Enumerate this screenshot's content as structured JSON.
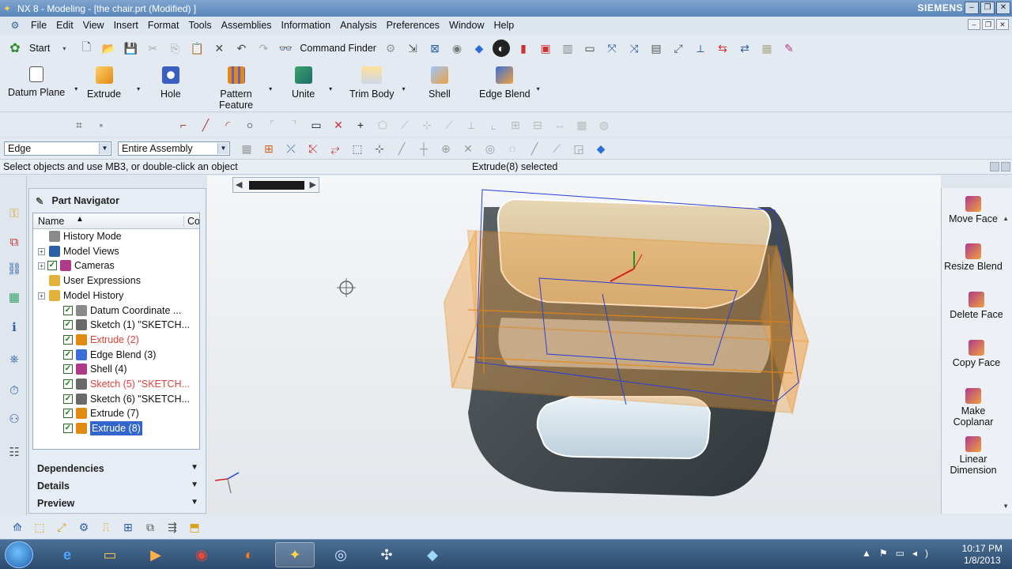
{
  "window": {
    "title": "NX 8 - Modeling - [the chair.prt (Modified) ]",
    "brand": "SIEMENS"
  },
  "menu": [
    "File",
    "Edit",
    "View",
    "Insert",
    "Format",
    "Tools",
    "Assemblies",
    "Information",
    "Analysis",
    "Preferences",
    "Window",
    "Help"
  ],
  "toolbar": {
    "start_label": "Start",
    "command_finder_label": "Command Finder"
  },
  "ribbon": [
    {
      "label": "Datum Plane",
      "icon": "datum-plane-icon"
    },
    {
      "label": "Extrude",
      "icon": "extrude-icon"
    },
    {
      "label": "Hole",
      "icon": "hole-icon"
    },
    {
      "label": "Pattern\nFeature",
      "icon": "pattern-feature-icon"
    },
    {
      "label": "Unite",
      "icon": "unite-icon"
    },
    {
      "label": "Trim Body",
      "icon": "trim-body-icon"
    },
    {
      "label": "Shell",
      "icon": "shell-icon"
    },
    {
      "label": "Edge Blend",
      "icon": "edge-blend-icon"
    }
  ],
  "selection": {
    "filter": "Edge",
    "scope": "Entire Assembly"
  },
  "status": {
    "prompt": "Select objects and use MB3, or double-click an object",
    "message": "Extrude(8) selected"
  },
  "navigator": {
    "title": "Part Navigator",
    "columns": {
      "name": "Name",
      "sort": "▲",
      "other": "Co"
    },
    "items": [
      {
        "label": "History Mode",
        "indent": 0,
        "expand": false,
        "check": false,
        "icon": "history-mode-icon",
        "red": false
      },
      {
        "label": "Model Views",
        "indent": 0,
        "expand": true,
        "check": false,
        "icon": "model-views-icon",
        "red": false
      },
      {
        "label": "Cameras",
        "indent": 0,
        "expand": true,
        "check": true,
        "icon": "cameras-icon",
        "red": false
      },
      {
        "label": "User Expressions",
        "indent": 0,
        "expand": false,
        "check": false,
        "icon": "folder-icon",
        "red": false
      },
      {
        "label": "Model History",
        "indent": 0,
        "expand": true,
        "check": false,
        "icon": "folder-icon",
        "red": false
      },
      {
        "label": "Datum Coordinate ...",
        "indent": 1,
        "expand": false,
        "check": true,
        "icon": "datum-csys-icon",
        "red": false
      },
      {
        "label": "Sketch (1) \"SKETCH...",
        "indent": 1,
        "expand": false,
        "check": true,
        "icon": "sketch-icon",
        "red": false
      },
      {
        "label": "Extrude (2)",
        "indent": 1,
        "expand": false,
        "check": true,
        "icon": "extrude-icon",
        "red": true
      },
      {
        "label": "Edge Blend (3)",
        "indent": 1,
        "expand": false,
        "check": true,
        "icon": "edge-blend-icon",
        "red": false
      },
      {
        "label": "Shell (4)",
        "indent": 1,
        "expand": false,
        "check": true,
        "icon": "shell-icon",
        "red": false
      },
      {
        "label": "Sketch (5) \"SKETCH...",
        "indent": 1,
        "expand": false,
        "check": true,
        "icon": "sketch-icon",
        "red": true
      },
      {
        "label": "Sketch (6) \"SKETCH...",
        "indent": 1,
        "expand": false,
        "check": true,
        "icon": "sketch-icon",
        "red": false
      },
      {
        "label": "Extrude (7)",
        "indent": 1,
        "expand": false,
        "check": true,
        "icon": "extrude-icon",
        "red": false
      },
      {
        "label": "Extrude (8)",
        "indent": 1,
        "expand": false,
        "check": true,
        "icon": "extrude-icon",
        "red": false,
        "selected": true
      }
    ],
    "sections": [
      "Dependencies",
      "Details",
      "Preview"
    ]
  },
  "right_panel": [
    {
      "label": "Move Face",
      "icon": "move-face-icon"
    },
    {
      "label": "Resize Blend",
      "icon": "resize-blend-icon"
    },
    {
      "label": "Delete Face",
      "icon": "delete-face-icon"
    },
    {
      "label": "Copy Face",
      "icon": "copy-face-icon"
    },
    {
      "label": "Make\nCoplanar",
      "icon": "make-coplanar-icon"
    },
    {
      "label": "Linear\nDimension",
      "icon": "linear-dimension-icon"
    }
  ],
  "taskbar": {
    "time": "10:17 PM",
    "date": "1/8/2013"
  },
  "colors": {
    "selection": "#3366cc",
    "feature_error": "#e0413a",
    "preview_orange": "#f0a040",
    "titlebar": "#5a86bb"
  }
}
